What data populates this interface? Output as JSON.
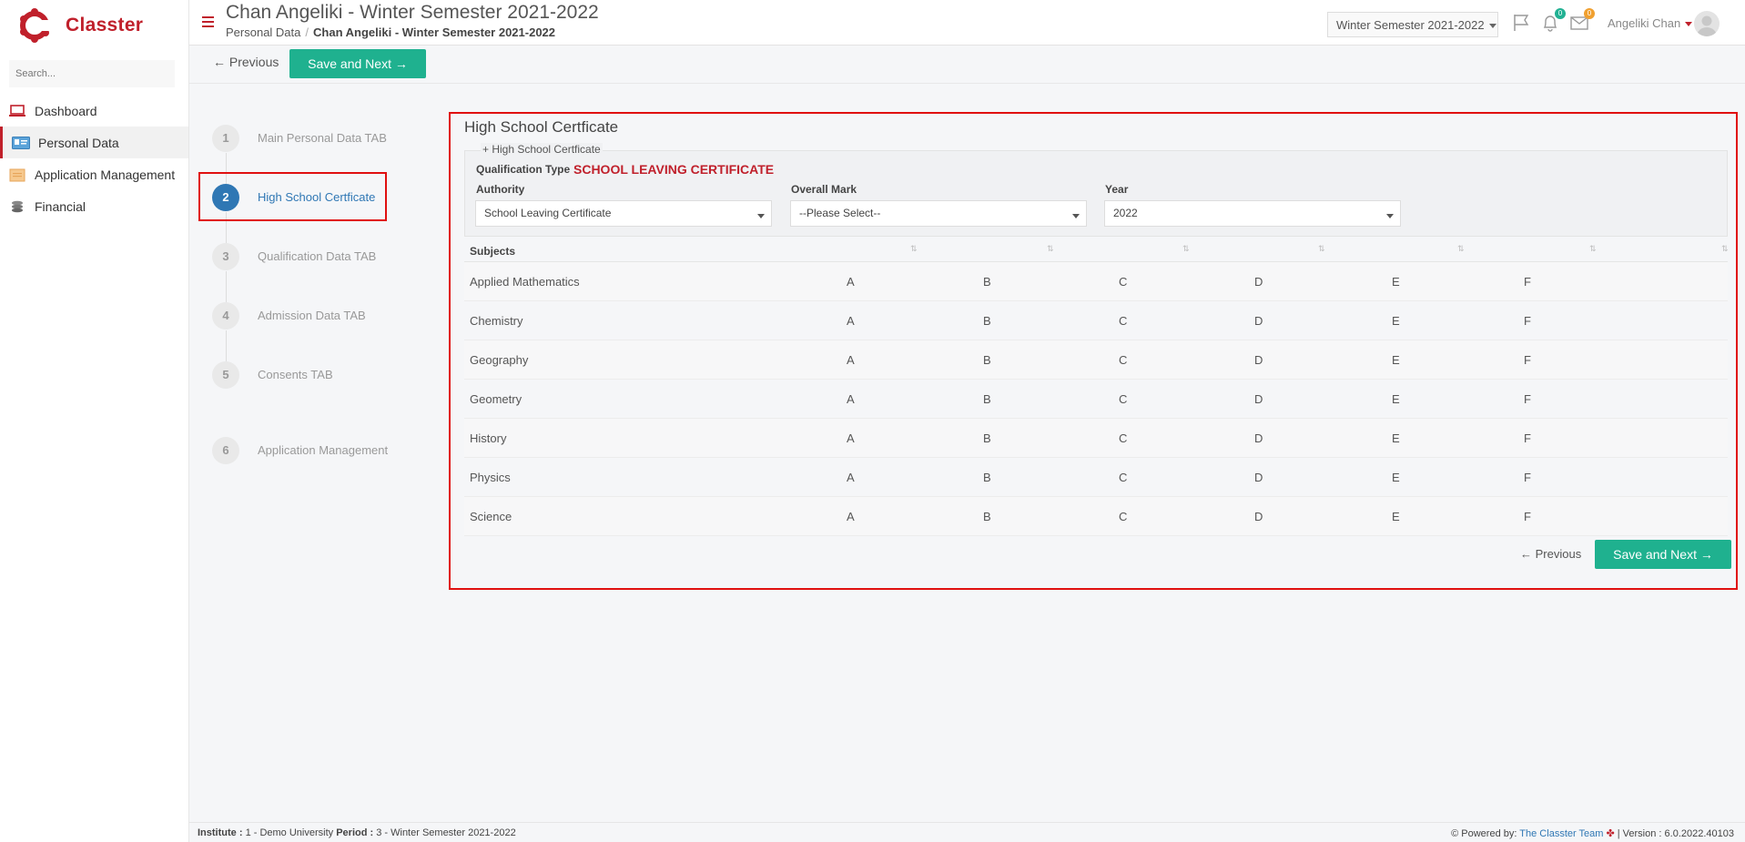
{
  "app": {
    "name": "Classter"
  },
  "sidebar": {
    "search_placeholder": "Search...",
    "items": [
      {
        "label": "Dashboard",
        "icon": "laptop-icon"
      },
      {
        "label": "Personal Data",
        "icon": "id-card-icon"
      },
      {
        "label": "Application Management",
        "icon": "folder-icon"
      },
      {
        "label": "Financial",
        "icon": "coins-icon"
      }
    ]
  },
  "header": {
    "title": "Chan Angeliki - Winter Semester 2021-2022",
    "breadcrumb_root": "Personal Data",
    "breadcrumb_current": "Chan Angeliki - Winter Semester 2021-2022",
    "semester": "Winter Semester 2021-2022",
    "notifications_count": "0",
    "messages_count": "0",
    "user_name": "Angeliki Chan"
  },
  "toolbar": {
    "prev_label": "← Previous",
    "save_next_label": "Save and Next →"
  },
  "steps": [
    {
      "num": "1",
      "label": "Main Personal Data TAB"
    },
    {
      "num": "2",
      "label": "High School Certficate"
    },
    {
      "num": "3",
      "label": "Qualification Data TAB"
    },
    {
      "num": "4",
      "label": "Admission Data TAB"
    },
    {
      "num": "5",
      "label": "Consents TAB"
    },
    {
      "num": "6",
      "label": "Application Management"
    }
  ],
  "panel": {
    "title": "High School Certficate",
    "add_label": "+ High School Certficate",
    "qualification_type_label": "Qualification Type",
    "qualification_type_value": "SCHOOL LEAVING CERTIFICATE",
    "authority_label": "Authority",
    "authority_value": "School Leaving Certificate",
    "overall_mark_label": "Overall Mark",
    "overall_mark_value": "--Please Select--",
    "year_label": "Year",
    "year_value": "2022"
  },
  "table": {
    "header": "Subjects",
    "grades": [
      "A",
      "B",
      "C",
      "D",
      "E",
      "F"
    ],
    "rows": [
      "Applied Mathematics",
      "Chemistry",
      "Geography",
      "Geometry",
      "History",
      "Physics",
      "Science"
    ]
  },
  "bottom": {
    "prev_label": "← Previous",
    "save_next_label": "Save and Next →"
  },
  "footer": {
    "institute_label": "Institute :",
    "institute_value": "1 - Demo University",
    "period_label": "Period :",
    "period_value": "3 - Winter Semester 2021-2022",
    "powered_by": "Powered by:",
    "team": "The Classter Team",
    "version": "| Version : 6.0.2022.40103"
  },
  "colors": {
    "brand": "#c0202b",
    "accent": "#1fb18f",
    "step_active": "#2f77b4",
    "highlight": "#e01010"
  }
}
